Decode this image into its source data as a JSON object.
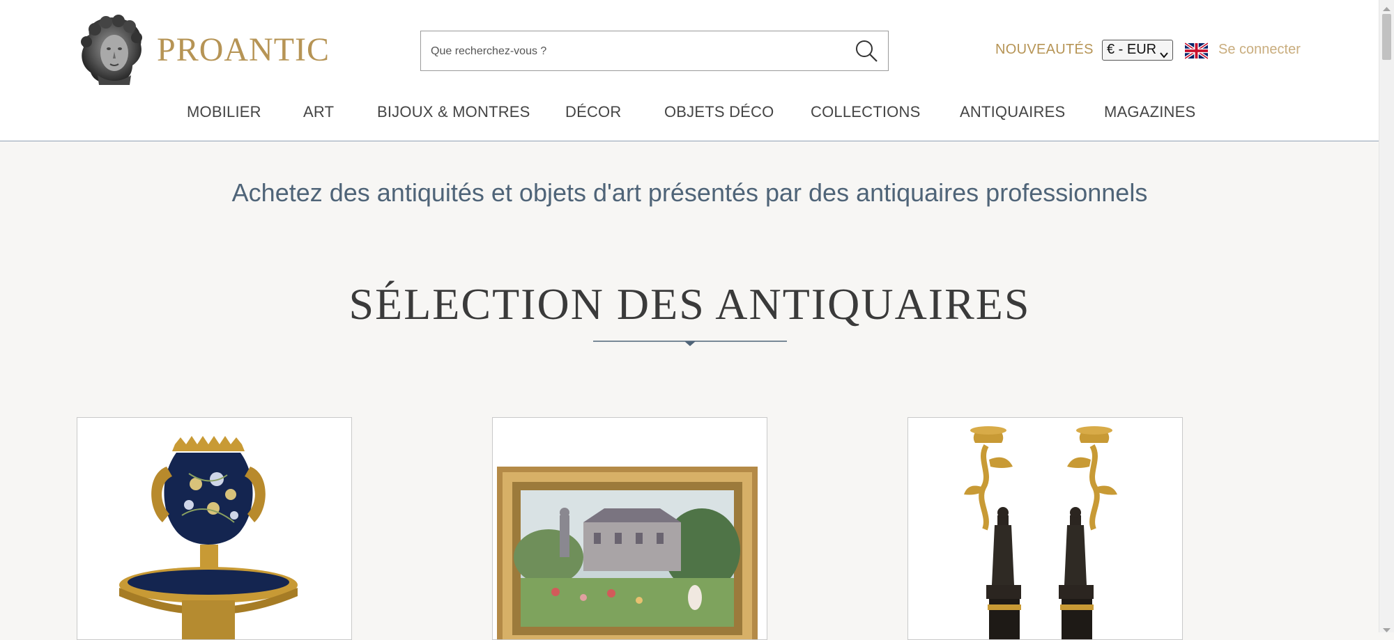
{
  "header": {
    "logo_text": "PROANTIC",
    "search": {
      "placeholder": "Que recherchez-vous ?"
    },
    "nouveautes_label": "NOUVEAUTÉS",
    "currency_selected": "€ - EUR",
    "language_flag": "uk-flag-icon",
    "login_label": "Se connecter"
  },
  "nav": {
    "items": [
      {
        "label": "MOBILIER"
      },
      {
        "label": "ART"
      },
      {
        "label": "BIJOUX & MONTRES"
      },
      {
        "label": "DÉCOR"
      },
      {
        "label": "OBJETS DÉCO"
      },
      {
        "label": "COLLECTIONS"
      },
      {
        "label": "ANTIQUAIRES"
      },
      {
        "label": "MAGAZINES"
      }
    ]
  },
  "main": {
    "tagline": "Achetez des antiquités et objets d'art présentés par des antiquaires professionnels",
    "section_title": "SÉLECTION DES ANTIQUAIRES",
    "cards": [
      {
        "image": "porcelain-vase-with-gilt-bronze-mount"
      },
      {
        "image": "framed-garden-landscape-painting"
      },
      {
        "image": "pair-of-gilt-bronze-candelabra-with-figures"
      }
    ]
  },
  "colors": {
    "brand_gold": "#b69455",
    "login_gold": "#c9ad7e",
    "tagline_blue": "#4f6478",
    "page_background": "#f7f6f4"
  }
}
